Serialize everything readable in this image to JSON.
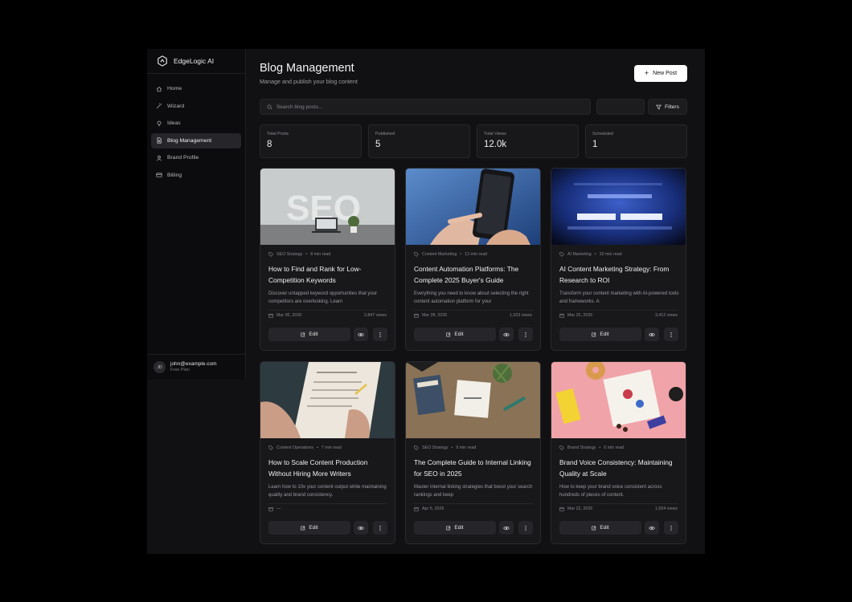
{
  "app": {
    "name": "EdgeLogic AI"
  },
  "sidebar": {
    "items": [
      {
        "label": "Home",
        "icon": "home-icon",
        "active": false
      },
      {
        "label": "Wizard",
        "icon": "wand-icon",
        "active": false
      },
      {
        "label": "Ideas",
        "icon": "lightbulb-icon",
        "active": false
      },
      {
        "label": "Blog Management",
        "icon": "file-text-icon",
        "active": true
      },
      {
        "label": "Brand Profile",
        "icon": "user-icon",
        "active": false
      },
      {
        "label": "Billing",
        "icon": "credit-card-icon",
        "active": false
      }
    ],
    "user": {
      "initials": "JD",
      "email": "john@example.com",
      "plan": "Free Plan"
    }
  },
  "header": {
    "title": "Blog Management",
    "subtitle": "Manage and publish your blog content",
    "new_post_label": "New Post"
  },
  "toolbar": {
    "search_placeholder": "Search blog posts...",
    "filters_label": "Filters"
  },
  "stats": [
    {
      "label": "Total Posts",
      "value": "8"
    },
    {
      "label": "Published",
      "value": "5"
    },
    {
      "label": "Total Views",
      "value": "12.0k"
    },
    {
      "label": "Scheduled",
      "value": "1"
    }
  ],
  "posts": [
    {
      "category": "SEO Strategy",
      "read_time": "8 min read",
      "title": "How to Find and Rank for Low-Competition Keywords",
      "excerpt": "Discover untapped keyword opportunities that your competitors are overlooking. Learn",
      "date": "Mar 30, 2026",
      "views": "2,847 views",
      "edit_label": "Edit",
      "image": "seo-desk"
    },
    {
      "category": "Content Marketing",
      "read_time": "12 min read",
      "title": "Content Automation Platforms: The Complete 2025 Buyer's Guide",
      "excerpt": "Everything you need to know about selecting the right content automation platform for your",
      "date": "Mar 28, 2026",
      "views": "1,923 views",
      "edit_label": "Edit",
      "image": "phone-hand"
    },
    {
      "category": "AI Marketing",
      "read_time": "10 min read",
      "title": "AI Content Marketing Strategy: From Research to ROI",
      "excerpt": "Transform your content marketing with AI-powered tools and frameworks. A",
      "date": "Mar 25, 2026",
      "views": "3,412 views",
      "edit_label": "Edit",
      "image": "blue-screen"
    },
    {
      "category": "Content Operations",
      "read_time": "7 min read",
      "title": "How to Scale Content Production Without Hiring More Writers",
      "excerpt": "Learn how to 10x your content output while maintaining quality and brand consistency.",
      "date": "—",
      "views": "",
      "edit_label": "Edit",
      "image": "paper-writing"
    },
    {
      "category": "SEO Strategy",
      "read_time": "9 min read",
      "title": "The Complete Guide to Internal Linking for SEO in 2025",
      "excerpt": "Master internal linking strategies that boost your search rankings and keep",
      "date": "Apr 5, 2026",
      "views": "",
      "edit_label": "Edit",
      "image": "desk-notes"
    },
    {
      "category": "Brand Strategy",
      "read_time": "6 min read",
      "title": "Brand Voice Consistency: Maintaining Quality at Scale",
      "excerpt": "How to keep your brand voice consistent across hundreds of pieces of content.",
      "date": "Mar 22, 2026",
      "views": "1,654 views",
      "edit_label": "Edit",
      "image": "pink-brand"
    }
  ],
  "colors": {
    "background": "#111113",
    "sidebar": "#0c0c0e",
    "card": "#18181b",
    "active_item": "#26262a",
    "primary_button": "#ffffff"
  }
}
